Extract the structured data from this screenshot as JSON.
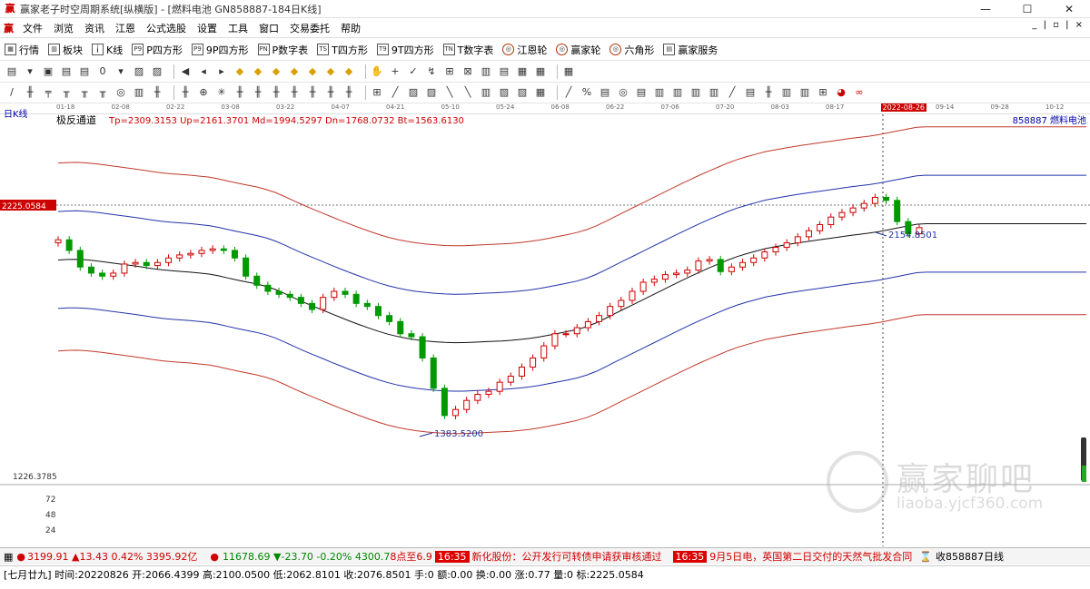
{
  "window": {
    "title": "赢家老子时空周期系统[纵横版] - [燃料电池  GN858887-184日K线]",
    "controls": [
      "—",
      "☐",
      "✕"
    ],
    "mdi_controls": "_ | ▫ | ×"
  },
  "menu": [
    "文件",
    "浏览",
    "资讯",
    "江恩",
    "公式选股",
    "设置",
    "工具",
    "窗口",
    "交易委托",
    "帮助"
  ],
  "toolbar1": [
    {
      "icon": "table-icon",
      "glyph": "▦",
      "label": "行情"
    },
    {
      "icon": "blocks-icon",
      "glyph": "▥",
      "label": "板块"
    },
    {
      "icon": "kline-icon",
      "glyph": "╽",
      "label": "K线"
    },
    {
      "icon": "p-square-icon",
      "glyph": "P9",
      "label": "P四方形"
    },
    {
      "icon": "9p-square-icon",
      "glyph": "P9",
      "label": "9P四方形"
    },
    {
      "icon": "p-number-icon",
      "glyph": "PN",
      "label": "P数字表"
    },
    {
      "icon": "t-square-icon",
      "glyph": "TS",
      "label": "T四方形"
    },
    {
      "icon": "9t-square-icon",
      "glyph": "T9",
      "label": "9T四方形"
    },
    {
      "icon": "t-number-icon",
      "glyph": "TN",
      "label": "T数字表"
    },
    {
      "icon": "gann-wheel-icon",
      "glyph": "◎",
      "label": "江恩轮"
    },
    {
      "icon": "winner-wheel-icon",
      "glyph": "◎",
      "label": "赢家轮"
    },
    {
      "icon": "hexagon-icon",
      "glyph": "◎",
      "label": "六角形"
    },
    {
      "icon": "service-icon",
      "glyph": "▤",
      "label": "赢家服务"
    }
  ],
  "toolbar2": [
    "▤",
    "▾",
    "▣",
    "▤",
    "▤",
    "0",
    "▾",
    "▨",
    "▨",
    "◀",
    "◂",
    "▸",
    "◆",
    "◆",
    "◆",
    "◆",
    "◆",
    "◆",
    "◆",
    "✋",
    "+",
    "✓",
    "↯",
    "⊞",
    "⊠",
    "▥",
    "▤",
    "▦",
    "▦",
    "▦"
  ],
  "toolbar3": [
    "/",
    "╫",
    "╤",
    "╥",
    "╥",
    "╥",
    "◎",
    "▥",
    "╫",
    "╫",
    "⊕",
    "✳",
    "╫",
    "╫",
    "╫",
    "╫",
    "╫",
    "╫",
    "╫",
    "⊞",
    "╱",
    "▨",
    "▨",
    "╲",
    "╲",
    "▥",
    "▨",
    "▨",
    "▦",
    "╱",
    "%",
    "▤",
    "◎",
    "▤",
    "▥",
    "▥",
    "▥",
    "▥",
    "╱",
    "▤",
    "╫",
    "▥",
    "▥",
    "⊞",
    "◕",
    "∞"
  ],
  "dates": [
    "01-18",
    "02-08",
    "02-22",
    "03-08",
    "03-22",
    "04-07",
    "04-21",
    "05-10",
    "05-24",
    "06-08",
    "06-22",
    "07-06",
    "07-20",
    "08-03",
    "08-17",
    "2022-08-26",
    "09-14",
    "09-28",
    "10-12"
  ],
  "chart_data": {
    "type": "candlestick",
    "period_label": "日K线",
    "indicator_name": "极反通道",
    "indicator_values": "Tp=2309.3153  Up=2161.3701  Md=1994.5297  Dn=1768.0732  Bt=1563.6130",
    "symbol_label": "858887  燃料电池",
    "price_axis_label": "2225.0584",
    "low_axis_label": "1226.3785",
    "volume_ticks": [
      "72",
      "48",
      "24"
    ],
    "high_marker": "2154.8501",
    "low_marker": "1383.5200",
    "closes": [
      2010,
      1975,
      1920,
      1900,
      1890,
      1900,
      1930,
      1935,
      1925,
      1935,
      1950,
      1960,
      1965,
      1975,
      1980,
      1975,
      1950,
      1890,
      1860,
      1840,
      1830,
      1820,
      1800,
      1780,
      1820,
      1840,
      1830,
      1800,
      1790,
      1760,
      1740,
      1700,
      1690,
      1620,
      1520,
      1430,
      1450,
      1480,
      1500,
      1510,
      1540,
      1560,
      1590,
      1620,
      1660,
      1700,
      1700,
      1720,
      1740,
      1760,
      1790,
      1810,
      1840,
      1870,
      1880,
      1895,
      1900,
      1910,
      1940,
      1945,
      1905,
      1920,
      1935,
      1950,
      1970,
      1985,
      2000,
      2020,
      2040,
      2060,
      2085,
      2100,
      2115,
      2130,
      2150,
      2140,
      2070,
      2030,
      2050
    ]
  },
  "status": {
    "sh_index": "3199.91",
    "sh_change": "▲13.43 0.42% 3395.92亿",
    "sz_index": "11678.69",
    "sz_change": "▼-23.70 -0.20% 4300.7",
    "news_prefix": "8点至6.9",
    "news1_time": "16:35",
    "news1_text": "新化股份：公开发行可转债申请获审核通过",
    "news2_time": "16:35",
    "news2_text": "9月5日电，英国第二日交付的天然气批发合同",
    "watch": "收858887日线"
  },
  "infobar": "[七月廿九] 时间:20220826 开:2066.4399 高:2100.0500 低:2062.8101 收:2076.8501 手:0 额:0.00 换:0.00 涨:0.77 量:0 标:2225.0584",
  "watermark": {
    "brand": "赢家聊吧",
    "url": "liaoba.yjcf360.com"
  }
}
